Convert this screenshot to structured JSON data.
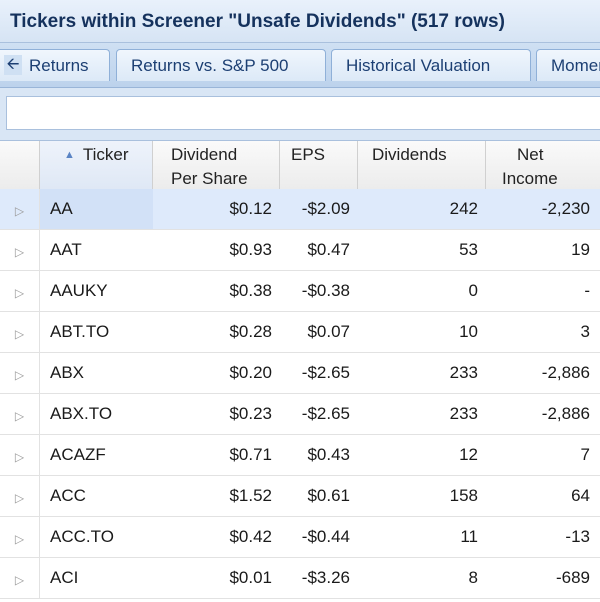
{
  "window": {
    "title": "Tickers within Screener \"Unsafe Dividends\" (517 rows)"
  },
  "tabs": [
    {
      "label": "Returns"
    },
    {
      "label": "Returns vs. S&P 500"
    },
    {
      "label": "Historical Valuation"
    },
    {
      "label": "Momentum"
    }
  ],
  "icons": {
    "scroll_left": "arrow-left-icon",
    "row_expander": "triangle-right-icon",
    "sort": "sort-ascending-icon"
  },
  "colors": {
    "title_text": "#15325d",
    "selected_row": "#deeafb",
    "header_bg": "#d6e4f4"
  },
  "grid": {
    "columns": [
      {
        "line1": "Ticker",
        "line2": "",
        "sorted": "ascending"
      },
      {
        "line1": "Dividend",
        "line2": "Per Share"
      },
      {
        "line1": "EPS",
        "line2": ""
      },
      {
        "line1": "Dividends",
        "line2": ""
      },
      {
        "line1": "Net",
        "line2": "Income"
      }
    ],
    "rows": [
      {
        "ticker": "AA",
        "dps": "$0.12",
        "eps": "-$2.09",
        "dividends": "242",
        "net_income": "-2,230",
        "selected": true
      },
      {
        "ticker": "AAT",
        "dps": "$0.93",
        "eps": "$0.47",
        "dividends": "53",
        "net_income": "19"
      },
      {
        "ticker": "AAUKY",
        "dps": "$0.38",
        "eps": "-$0.38",
        "dividends": "0",
        "net_income": "-"
      },
      {
        "ticker": "ABT.TO",
        "dps": "$0.28",
        "eps": "$0.07",
        "dividends": "10",
        "net_income": "3"
      },
      {
        "ticker": "ABX",
        "dps": "$0.20",
        "eps": "-$2.65",
        "dividends": "233",
        "net_income": "-2,886"
      },
      {
        "ticker": "ABX.TO",
        "dps": "$0.23",
        "eps": "-$2.65",
        "dividends": "233",
        "net_income": "-2,886"
      },
      {
        "ticker": "ACAZF",
        "dps": "$0.71",
        "eps": "$0.43",
        "dividends": "12",
        "net_income": "7"
      },
      {
        "ticker": "ACC",
        "dps": "$1.52",
        "eps": "$0.61",
        "dividends": "158",
        "net_income": "64"
      },
      {
        "ticker": "ACC.TO",
        "dps": "$0.42",
        "eps": "-$0.44",
        "dividends": "11",
        "net_income": "-13"
      },
      {
        "ticker": "ACI",
        "dps": "$0.01",
        "eps": "-$3.26",
        "dividends": "8",
        "net_income": "-689"
      }
    ]
  }
}
